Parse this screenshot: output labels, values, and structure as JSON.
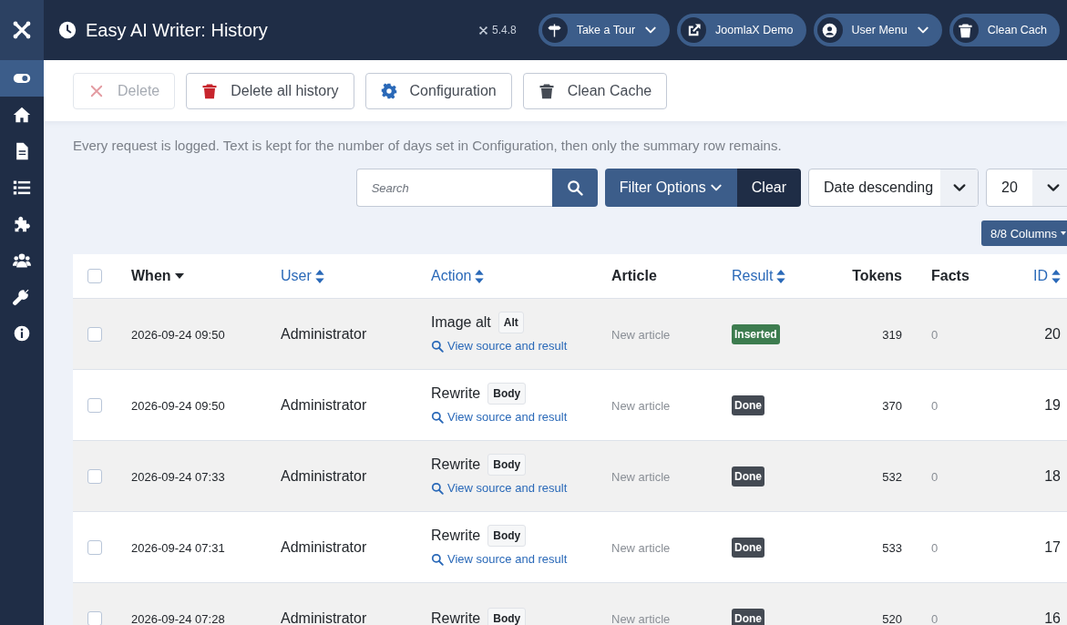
{
  "header": {
    "title": "Easy AI Writer: History",
    "version": "5.4.8",
    "buttons": [
      {
        "label": "Take a Tour",
        "kind": "signpost",
        "dropdown": true
      },
      {
        "label": "JoomlaX Demo",
        "kind": "external",
        "dropdown": false
      },
      {
        "label": "User Menu",
        "kind": "user",
        "dropdown": true
      },
      {
        "label": "Clean Cach",
        "kind": "trash",
        "dropdown": false
      }
    ]
  },
  "sidebar": {
    "items": [
      {
        "kind": "toggle",
        "selected": true
      },
      {
        "kind": "home",
        "selected": false
      },
      {
        "kind": "file",
        "selected": false
      },
      {
        "kind": "list",
        "selected": false
      },
      {
        "kind": "puzzle",
        "selected": false
      },
      {
        "kind": "users",
        "selected": false
      },
      {
        "kind": "wrench",
        "selected": false
      },
      {
        "kind": "info",
        "selected": false
      }
    ]
  },
  "toolbar": {
    "buttons": [
      {
        "label": "Delete",
        "kind": "close",
        "disabled": true
      },
      {
        "label": "Delete all history",
        "kind": "trash-red",
        "disabled": false
      },
      {
        "label": "Configuration",
        "kind": "gear",
        "disabled": false
      },
      {
        "label": "Clean Cache",
        "kind": "trash",
        "disabled": false
      }
    ]
  },
  "description": "Every request is logged. Text is kept for the number of days set in Configuration, then only the summary row remains.",
  "filters": {
    "search": {
      "placeholder": "Search"
    },
    "filter_button": "Filter Options",
    "clear_button": "Clear",
    "ordering": "Date descending",
    "limit": "20",
    "columns_button": "8/8 Columns"
  },
  "table": {
    "select_all": {
      "checked": false
    },
    "columns": [
      {
        "label": "When",
        "kind": "sorted"
      },
      {
        "label": "User",
        "kind": "sortable"
      },
      {
        "label": "Action",
        "kind": "sortable"
      },
      {
        "label": "Article",
        "kind": "plain"
      },
      {
        "label": "Result",
        "kind": "sortable"
      },
      {
        "label": "Tokens",
        "kind": "plain"
      },
      {
        "label": "Facts",
        "kind": "plain"
      },
      {
        "label": "ID",
        "kind": "sortable"
      }
    ],
    "rows": [
      {
        "checked": false,
        "when": "2026-09-24 09:50",
        "user": "Administrator",
        "action": "Image alt",
        "target": "Alt",
        "link": "View source and result",
        "article": "New article",
        "result": {
          "label": "Inserted",
          "color": "#3d7c4f"
        },
        "tokens": "319",
        "facts": "0",
        "id": "20"
      },
      {
        "checked": false,
        "when": "2026-09-24 09:50",
        "user": "Administrator",
        "action": "Rewrite",
        "target": "Body",
        "link": "View source and result",
        "article": "New article",
        "result": {
          "label": "Done",
          "color": "#444a53"
        },
        "tokens": "370",
        "facts": "0",
        "id": "19"
      },
      {
        "checked": false,
        "when": "2026-09-24 07:33",
        "user": "Administrator",
        "action": "Rewrite",
        "target": "Body",
        "link": "View source and result",
        "article": "New article",
        "result": {
          "label": "Done",
          "color": "#444a53"
        },
        "tokens": "532",
        "facts": "0",
        "id": "18"
      },
      {
        "checked": false,
        "when": "2026-09-24 07:31",
        "user": "Administrator",
        "action": "Rewrite",
        "target": "Body",
        "link": "View source and result",
        "article": "New article",
        "result": {
          "label": "Done",
          "color": "#444a53"
        },
        "tokens": "533",
        "facts": "0",
        "id": "17"
      },
      {
        "checked": false,
        "when": "2026-09-24 07:28",
        "user": "Administrator",
        "action": "Rewrite",
        "target": "Body",
        "article": "New article",
        "result": {
          "label": "Done",
          "color": "#444a53"
        },
        "tokens": "520",
        "facts": "0",
        "id": "16"
      }
    ]
  }
}
